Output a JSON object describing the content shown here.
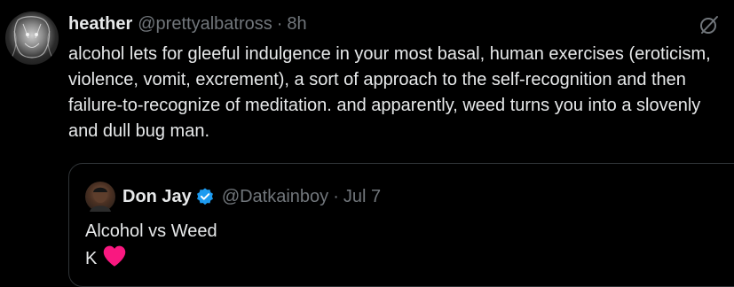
{
  "tweet": {
    "display_name": "heather",
    "handle": "@prettyalbatross",
    "separator": "·",
    "time": "8h",
    "text": "alcohol lets for gleeful indulgence in your most basal, human exercises (eroticism, violence, vomit, excrement), a sort of approach to the self-recognition and then failure-to-recognize of meditation. and apparently, weed turns you into a slovenly and dull bug man.",
    "avatar_icon": "avatar",
    "action_icon": "grok-icon"
  },
  "quote": {
    "display_name": "Don Jay",
    "verified_icon": "verified-badge-icon",
    "handle": "@Datkainboy",
    "separator": "·",
    "date": "Jul 7",
    "lines": [
      "Alcohol vs Weed",
      "K"
    ],
    "heart_icon": "red-heart-icon"
  },
  "colors": {
    "background": "#000000",
    "text_primary": "#e7e9ea",
    "text_secondary": "#71767b",
    "border": "#2f3336",
    "verified_blue": "#1d9bf0",
    "heart_red": "#f91880"
  }
}
